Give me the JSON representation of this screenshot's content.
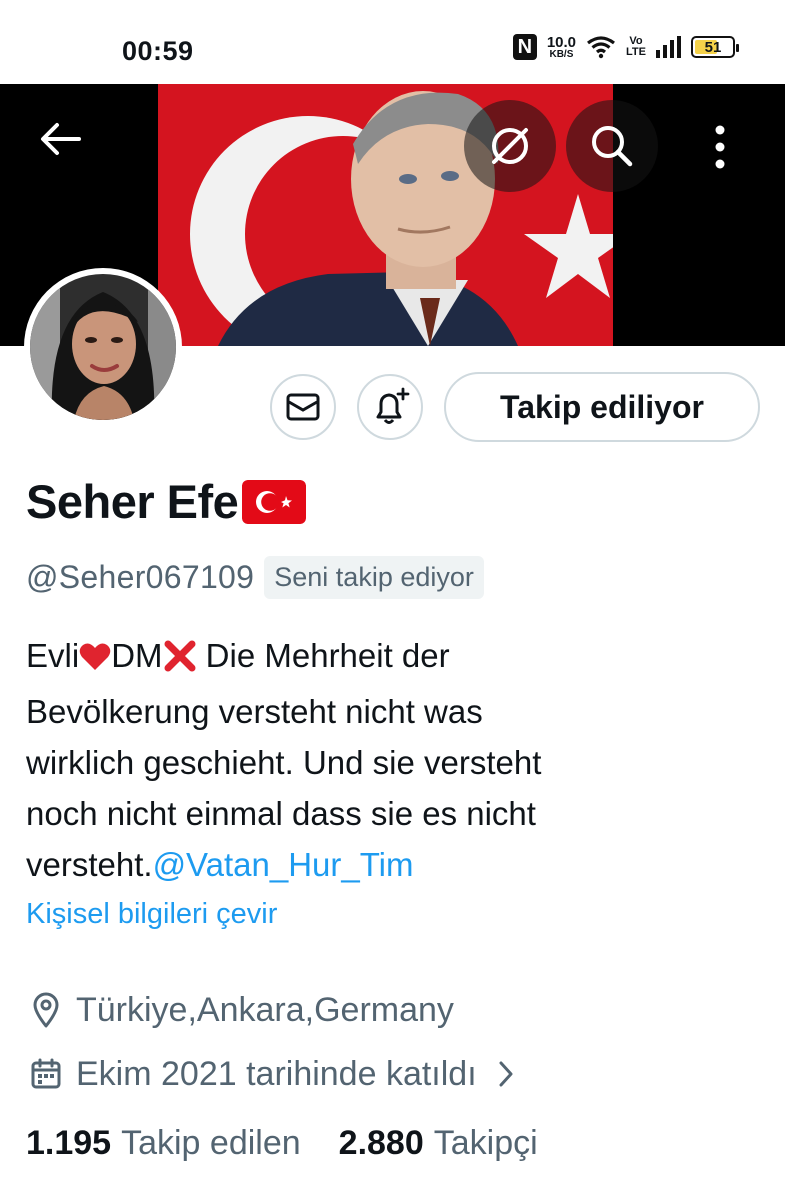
{
  "status_bar": {
    "time": "00:59",
    "net_speed_value": "10.0",
    "net_speed_unit": "KB/S",
    "volte_top": "Vo",
    "volte_bottom": "LTE",
    "battery": "51"
  },
  "header": {
    "back_icon": "arrow-left-icon",
    "grok_icon": "slash-circle-icon",
    "search_icon": "search-icon",
    "more_icon": "more-vertical-icon"
  },
  "actions": {
    "message_icon": "envelope-icon",
    "notify_icon": "bell-plus-icon",
    "follow_label": "Takip ediliyor"
  },
  "profile": {
    "name": "Seher Efe",
    "handle": "@Seher067109",
    "follows_you": "Seni takip ediyor",
    "bio_prefix": "Evli",
    "bio_dm": "DM",
    "bio_line1_rest": " Die Mehrheit der",
    "bio_line2": "Bevölkerung versteht nicht was",
    "bio_line3": "wirklich geschieht. Und sie versteht",
    "bio_line4": "noch nicht einmal dass sie es nicht",
    "bio_line5_text": "versteht.",
    "bio_mention": "@Vatan_Hur_Tim",
    "translate_label": "Kişisel bilgileri çevir",
    "location": "Türkiye,Ankara,Germany",
    "joined": "Ekim 2021 tarihinde katıldı",
    "following_count": "1.195",
    "following_label": "Takip edilen",
    "followers_count": "2.880",
    "followers_label": "Takipçi"
  },
  "colors": {
    "accent": "#1d9bf0",
    "secondary_text": "#536471",
    "border": "#cfd9de",
    "flag_red": "#e30a17"
  }
}
